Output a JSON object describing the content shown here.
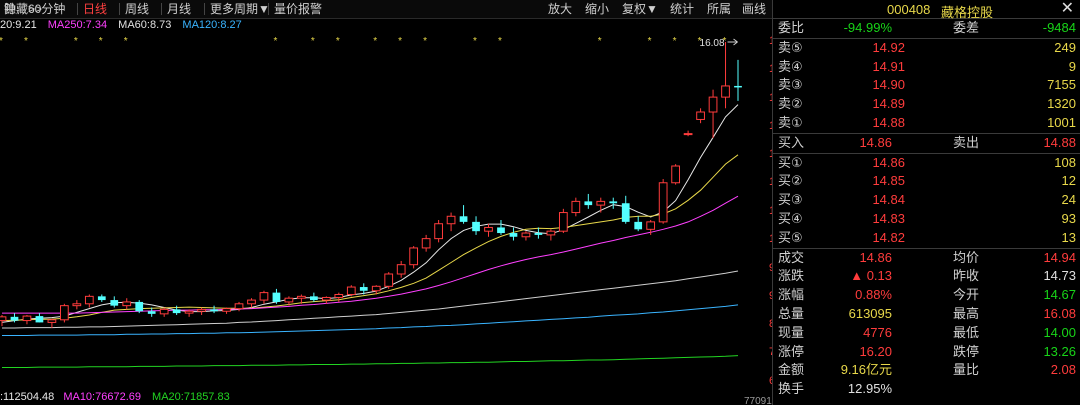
{
  "toolbar": {
    "tabs": [
      "钟",
      "60分钟",
      "日线",
      "周线",
      "月线",
      "更多周期▼",
      "量价报警"
    ],
    "active_index": 2,
    "right_tabs": [
      "放大",
      "缩小",
      "复权▼",
      "统计",
      "所属",
      "画线",
      "隐藏>>"
    ]
  },
  "indicators": {
    "ma20": "20:9.21",
    "ma250": "MA250:7.34",
    "ma60": "MA60:8.73",
    "ma120": "MA120:8.27"
  },
  "volume_line": {
    "vol": ":112504.48",
    "ma10": "MA10:76672.69",
    "ma20": "MA20:71857.83",
    "right_axis": "77091"
  },
  "chart_data": {
    "type": "candlestick",
    "ymin": 6.95,
    "ymax": 16.08,
    "y_ticks": [
      "16.08",
      "15.33",
      "14.56",
      "13.81",
      "13.04",
      "12.29",
      "11.51",
      "10.77",
      "9.99",
      "9.24",
      "8.47",
      "7.72",
      "6.95"
    ],
    "high_marker": "16.08",
    "candles": [
      [
        8.6,
        8.75,
        8.45,
        8.7
      ],
      [
        8.7,
        8.8,
        8.55,
        8.6
      ],
      [
        8.6,
        8.75,
        8.5,
        8.72
      ],
      [
        8.72,
        8.8,
        8.55,
        8.55
      ],
      [
        8.55,
        8.65,
        8.4,
        8.62
      ],
      [
        8.62,
        9.05,
        8.55,
        9.0
      ],
      [
        9.0,
        9.15,
        8.9,
        9.05
      ],
      [
        9.05,
        9.3,
        8.95,
        9.25
      ],
      [
        9.25,
        9.3,
        9.1,
        9.15
      ],
      [
        9.15,
        9.25,
        8.95,
        9.0
      ],
      [
        9.0,
        9.2,
        8.9,
        9.1
      ],
      [
        9.1,
        9.15,
        8.8,
        8.85
      ],
      [
        8.85,
        8.95,
        8.7,
        8.78
      ],
      [
        8.78,
        8.95,
        8.7,
        8.9
      ],
      [
        8.9,
        9.0,
        8.75,
        8.8
      ],
      [
        8.8,
        8.9,
        8.7,
        8.85
      ],
      [
        8.85,
        8.95,
        8.75,
        8.9
      ],
      [
        8.9,
        9.0,
        8.8,
        8.85
      ],
      [
        8.85,
        8.95,
        8.78,
        8.92
      ],
      [
        8.92,
        9.1,
        8.85,
        9.05
      ],
      [
        9.05,
        9.2,
        8.95,
        9.15
      ],
      [
        9.15,
        9.4,
        9.05,
        9.35
      ],
      [
        9.35,
        9.45,
        9.05,
        9.1
      ],
      [
        9.1,
        9.25,
        9.0,
        9.2
      ],
      [
        9.2,
        9.3,
        9.05,
        9.25
      ],
      [
        9.25,
        9.35,
        9.1,
        9.15
      ],
      [
        9.15,
        9.25,
        9.05,
        9.22
      ],
      [
        9.22,
        9.35,
        9.1,
        9.3
      ],
      [
        9.3,
        9.55,
        9.25,
        9.5
      ],
      [
        9.5,
        9.6,
        9.3,
        9.4
      ],
      [
        9.4,
        9.55,
        9.3,
        9.52
      ],
      [
        9.52,
        9.9,
        9.45,
        9.85
      ],
      [
        9.85,
        10.2,
        9.75,
        10.1
      ],
      [
        10.1,
        10.6,
        10.0,
        10.55
      ],
      [
        10.55,
        10.9,
        10.45,
        10.8
      ],
      [
        10.8,
        11.3,
        10.7,
        11.2
      ],
      [
        11.2,
        11.5,
        11.0,
        11.4
      ],
      [
        11.4,
        11.7,
        11.2,
        11.25
      ],
      [
        11.25,
        11.4,
        10.9,
        11.0
      ],
      [
        11.0,
        11.2,
        10.85,
        11.1
      ],
      [
        11.1,
        11.3,
        10.9,
        10.95
      ],
      [
        10.95,
        11.1,
        10.75,
        10.85
      ],
      [
        10.85,
        11.0,
        10.75,
        10.95
      ],
      [
        10.95,
        11.1,
        10.8,
        10.9
      ],
      [
        10.9,
        11.05,
        10.75,
        11.0
      ],
      [
        11.0,
        11.6,
        10.95,
        11.5
      ],
      [
        11.5,
        11.9,
        11.4,
        11.8
      ],
      [
        11.8,
        12.0,
        11.6,
        11.7
      ],
      [
        11.7,
        11.9,
        11.5,
        11.8
      ],
      [
        11.8,
        11.9,
        11.6,
        11.75
      ],
      [
        11.75,
        11.95,
        11.2,
        11.25
      ],
      [
        11.25,
        11.4,
        11.0,
        11.05
      ],
      [
        11.05,
        11.3,
        10.9,
        11.25
      ],
      [
        11.25,
        12.4,
        11.2,
        12.3
      ],
      [
        12.3,
        12.8,
        12.25,
        12.75
      ],
      [
        13.6,
        13.7,
        13.55,
        13.62
      ],
      [
        14.0,
        14.3,
        13.9,
        14.2
      ],
      [
        14.2,
        14.8,
        13.5,
        14.6
      ],
      [
        14.6,
        16.08,
        14.3,
        14.9
      ],
      [
        14.9,
        15.6,
        14.5,
        14.86
      ]
    ],
    "ma_lines": [
      {
        "name": "MA5",
        "color": "#e8e8e8",
        "values": [
          8.55,
          8.6,
          8.64,
          8.66,
          8.68,
          8.72,
          8.82,
          8.92,
          9.02,
          9.08,
          9.09,
          9.07,
          9.02,
          8.95,
          8.88,
          8.84,
          8.84,
          8.86,
          8.87,
          8.9,
          8.95,
          9.04,
          9.1,
          9.17,
          9.21,
          9.21,
          9.19,
          9.22,
          9.29,
          9.33,
          9.39,
          9.52,
          9.68,
          9.9,
          10.15,
          10.5,
          10.8,
          11.02,
          11.13,
          11.19,
          11.19,
          11.12,
          11.02,
          10.96,
          10.93,
          11.04,
          11.21,
          11.38,
          11.56,
          11.71,
          11.66,
          11.51,
          11.38,
          11.52,
          11.82,
          12.38,
          12.98,
          13.52,
          14.07,
          14.4
        ]
      },
      {
        "name": "MA10",
        "color": "#e8d84a",
        "values": [
          8.6,
          8.61,
          8.62,
          8.63,
          8.64,
          8.66,
          8.7,
          8.75,
          8.82,
          8.88,
          8.9,
          8.92,
          8.93,
          8.94,
          8.95,
          8.96,
          8.95,
          8.94,
          8.93,
          8.93,
          8.93,
          8.96,
          8.99,
          9.03,
          9.08,
          9.11,
          9.13,
          9.16,
          9.22,
          9.27,
          9.32,
          9.4,
          9.49,
          9.6,
          9.74,
          9.95,
          10.16,
          10.37,
          10.55,
          10.72,
          10.86,
          10.97,
          11.05,
          11.08,
          11.07,
          11.1,
          11.15,
          11.2,
          11.25,
          11.3,
          11.37,
          11.4,
          11.4,
          11.46,
          11.6,
          11.83,
          12.1,
          12.45,
          12.8,
          13.05
        ]
      },
      {
        "name": "MA20",
        "color": "#ff40ff",
        "values": [
          8.8,
          8.8,
          8.8,
          8.8,
          8.8,
          8.8,
          8.8,
          8.81,
          8.82,
          8.83,
          8.84,
          8.85,
          8.86,
          8.87,
          8.88,
          8.88,
          8.89,
          8.89,
          8.9,
          8.91,
          8.92,
          8.94,
          8.96,
          8.98,
          9.01,
          9.03,
          9.06,
          9.09,
          9.12,
          9.16,
          9.2,
          9.25,
          9.31,
          9.38,
          9.45,
          9.54,
          9.64,
          9.75,
          9.86,
          9.97,
          10.07,
          10.16,
          10.24,
          10.31,
          10.37,
          10.44,
          10.52,
          10.6,
          10.68,
          10.75,
          10.83,
          10.9,
          10.97,
          11.05,
          11.14,
          11.25,
          11.4,
          11.56,
          11.75,
          11.94
        ]
      },
      {
        "name": "MA60",
        "color": "#cfcfcf",
        "values": [
          8.4,
          8.4,
          8.41,
          8.41,
          8.41,
          8.42,
          8.42,
          8.43,
          8.43,
          8.44,
          8.45,
          8.46,
          8.47,
          8.48,
          8.49,
          8.5,
          8.51,
          8.52,
          8.53,
          8.55,
          8.56,
          8.58,
          8.6,
          8.62,
          8.64,
          8.66,
          8.68,
          8.7,
          8.72,
          8.74,
          8.76,
          8.79,
          8.82,
          8.85,
          8.88,
          8.91,
          8.95,
          8.99,
          9.03,
          9.07,
          9.11,
          9.15,
          9.19,
          9.23,
          9.27,
          9.31,
          9.35,
          9.39,
          9.43,
          9.47,
          9.51,
          9.55,
          9.59,
          9.63,
          9.67,
          9.72,
          9.77,
          9.82,
          9.87,
          9.93
        ]
      },
      {
        "name": "MA120",
        "color": "#3ab4ff",
        "values": [
          8.2,
          8.2,
          8.2,
          8.21,
          8.21,
          8.21,
          8.21,
          8.22,
          8.22,
          8.22,
          8.23,
          8.23,
          8.24,
          8.24,
          8.25,
          8.25,
          8.26,
          8.26,
          8.27,
          8.27,
          8.28,
          8.29,
          8.3,
          8.31,
          8.32,
          8.33,
          8.34,
          8.35,
          8.36,
          8.37,
          8.38,
          8.4,
          8.41,
          8.43,
          8.44,
          8.46,
          8.47,
          8.49,
          8.51,
          8.53,
          8.55,
          8.57,
          8.59,
          8.61,
          8.63,
          8.65,
          8.67,
          8.69,
          8.72,
          8.74,
          8.76,
          8.78,
          8.81,
          8.83,
          8.86,
          8.89,
          8.92,
          8.95,
          8.98,
          9.02
        ]
      },
      {
        "name": "MA250",
        "color": "#22d422",
        "values": [
          7.34,
          7.34,
          7.34,
          7.35,
          7.35,
          7.35,
          7.35,
          7.36,
          7.36,
          7.36,
          7.36,
          7.37,
          7.37,
          7.37,
          7.38,
          7.38,
          7.38,
          7.39,
          7.39,
          7.39,
          7.4,
          7.4,
          7.4,
          7.41,
          7.41,
          7.42,
          7.42,
          7.42,
          7.43,
          7.43,
          7.44,
          7.44,
          7.45,
          7.45,
          7.46,
          7.46,
          7.47,
          7.47,
          7.48,
          7.48,
          7.49,
          7.5,
          7.5,
          7.51,
          7.52,
          7.52,
          7.53,
          7.54,
          7.54,
          7.55,
          7.56,
          7.57,
          7.58,
          7.59,
          7.6,
          7.61,
          7.62,
          7.63,
          7.64,
          7.66
        ]
      }
    ]
  },
  "panel": {
    "code": "000408",
    "name": "藏格控股",
    "close_icon": "✕",
    "weibi_label": "委比",
    "weibi_value": "-94.99%",
    "weicha_label": "委差",
    "weicha_value": "-9484",
    "asks": [
      {
        "label": "卖⑤",
        "price": "14.92",
        "vol": "249"
      },
      {
        "label": "卖④",
        "price": "14.91",
        "vol": "9"
      },
      {
        "label": "卖③",
        "price": "14.90",
        "vol": "7155"
      },
      {
        "label": "卖②",
        "price": "14.89",
        "vol": "1320"
      },
      {
        "label": "卖①",
        "price": "14.88",
        "vol": "1001"
      }
    ],
    "buyin_label": "买入",
    "buyin_value": "14.86",
    "sellout_label": "卖出",
    "sellout_value": "14.88",
    "bids": [
      {
        "label": "买①",
        "price": "14.86",
        "vol": "108"
      },
      {
        "label": "买②",
        "price": "14.85",
        "vol": "12"
      },
      {
        "label": "买③",
        "price": "14.84",
        "vol": "24"
      },
      {
        "label": "买④",
        "price": "14.83",
        "vol": "93"
      },
      {
        "label": "买⑤",
        "price": "14.82",
        "vol": "13"
      }
    ],
    "stats": [
      {
        "l1": "成交",
        "v1": "14.86",
        "c1": "red",
        "l2": "均价",
        "v2": "14.94",
        "c2": "red"
      },
      {
        "l1": "涨跌",
        "v1": "▲ 0.13",
        "c1": "red",
        "l2": "昨收",
        "v2": "14.73",
        "c2": "white"
      },
      {
        "l1": "涨幅",
        "v1": "0.88%",
        "c1": "red",
        "l2": "今开",
        "v2": "14.67",
        "c2": "green"
      },
      {
        "l1": "总量",
        "v1": "613095",
        "c1": "yellow",
        "l2": "最高",
        "v2": "16.08",
        "c2": "red"
      },
      {
        "l1": "现量",
        "v1": "4776",
        "c1": "red",
        "l2": "最低",
        "v2": "14.00",
        "c2": "green"
      },
      {
        "l1": "涨停",
        "v1": "16.20",
        "c1": "red",
        "l2": "跌停",
        "v2": "13.26",
        "c2": "green"
      },
      {
        "l1": "金额",
        "v1": "9.16亿元",
        "c1": "yellow",
        "l2": "量比",
        "v2": "2.08",
        "c2": "red"
      },
      {
        "l1": "换手",
        "v1": "12.95%",
        "c1": "white",
        "l2": "",
        "v2": "",
        "c2": "white"
      }
    ]
  }
}
